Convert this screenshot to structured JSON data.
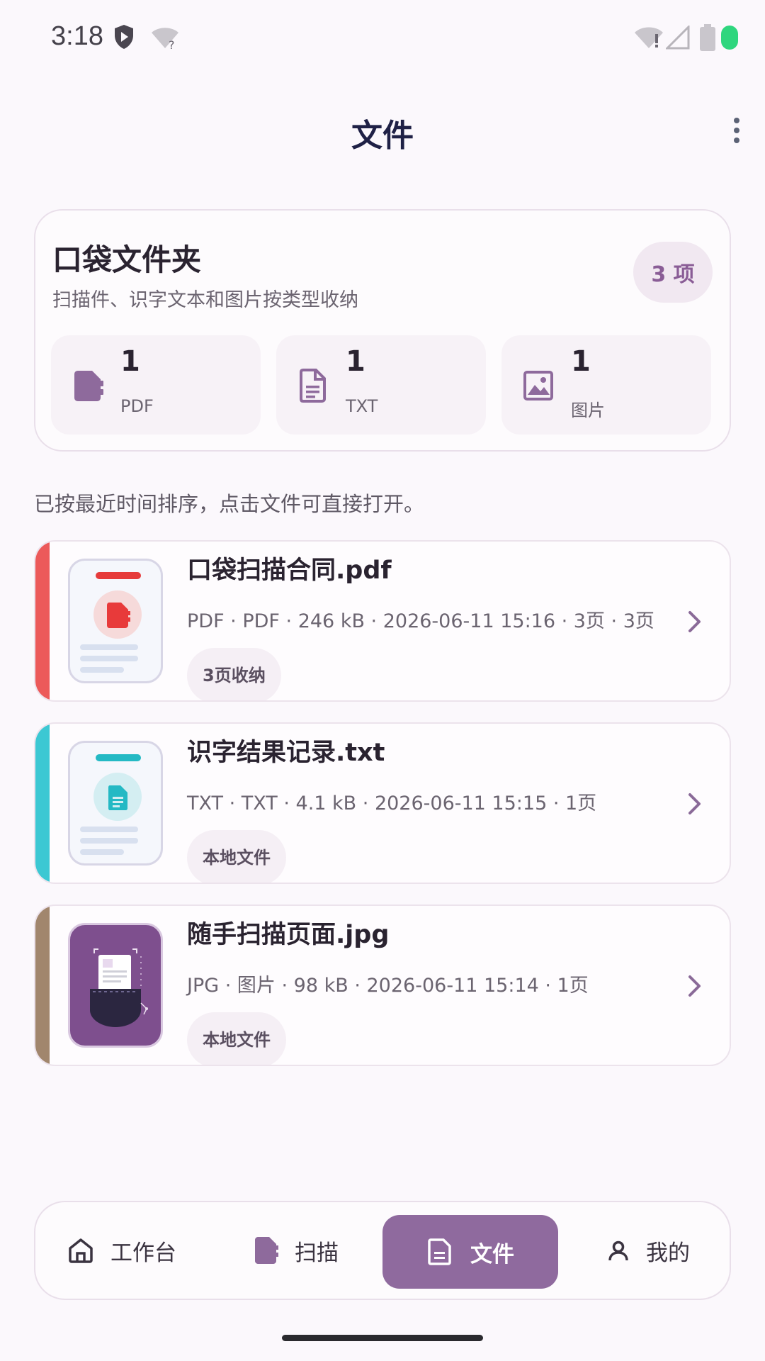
{
  "status": {
    "time": "3:18"
  },
  "appbar": {
    "title": "文件"
  },
  "summary": {
    "title": "口袋文件夹",
    "subtitle": "扫描件、识字文本和图片按类型收纳",
    "count": "3 项",
    "stats": [
      {
        "value": "1",
        "label": "PDF",
        "icon": "pdf-file-icon"
      },
      {
        "value": "1",
        "label": "TXT",
        "icon": "text-document-icon"
      },
      {
        "value": "1",
        "label": "图片",
        "icon": "image-icon"
      }
    ]
  },
  "hint": "已按最近时间排序，点击文件可直接打开。",
  "files": [
    {
      "name": "口袋扫描合同.pdf",
      "meta": "PDF · PDF · 246 kB · 2026-06-11 15:16 · 3页 · 3页",
      "tag": "3页收纳",
      "accent": "#ec5a5a",
      "icon_color": "#e83a3a"
    },
    {
      "name": "识字结果记录.txt",
      "meta": "TXT · TXT · 4.1 kB · 2026-06-11 15:15 · 1页",
      "tag": "本地文件",
      "accent": "#3cc8d3",
      "icon_color": "#24b9c4"
    },
    {
      "name": "随手扫描页面.jpg",
      "meta": "JPG · 图片 · 98 kB · 2026-06-11 15:14 · 1页",
      "tag": "本地文件",
      "accent": "#a1866d",
      "icon_color": "#7e4f8e"
    }
  ],
  "nav": {
    "items": [
      {
        "label": "工作台",
        "icon": "home-icon"
      },
      {
        "label": "扫描",
        "icon": "scan-icon"
      },
      {
        "label": "文件",
        "icon": "files-icon"
      },
      {
        "label": "我的",
        "icon": "person-icon"
      }
    ]
  },
  "colors": {
    "brand": "#8f6a9e",
    "background": "#fbf8fc"
  }
}
